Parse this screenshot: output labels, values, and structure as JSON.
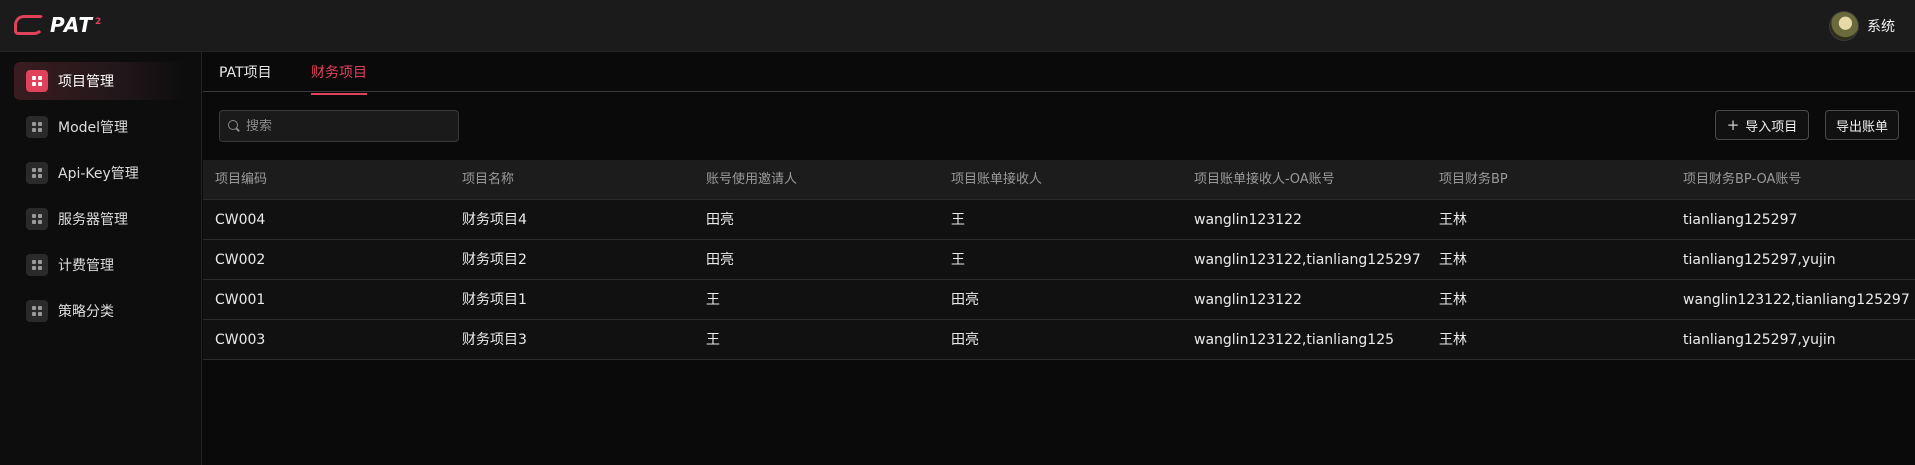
{
  "app": {
    "logo_text": "PAT",
    "logo_sup": "2"
  },
  "user": {
    "name": "系统"
  },
  "sidebar": {
    "items": [
      {
        "label": "项目管理",
        "active": true
      },
      {
        "label": "Model管理",
        "active": false
      },
      {
        "label": "Api-Key管理",
        "active": false
      },
      {
        "label": "服务器管理",
        "active": false
      },
      {
        "label": "计费管理",
        "active": false
      },
      {
        "label": "策略分类",
        "active": false
      }
    ]
  },
  "tabs": [
    {
      "label": "PAT项目",
      "active": false
    },
    {
      "label": "财务项目",
      "active": true
    }
  ],
  "search": {
    "placeholder": "搜索",
    "value": ""
  },
  "toolbar": {
    "import_label": "导入项目",
    "export_label": "导出账单"
  },
  "table": {
    "columns": [
      "项目编码",
      "项目名称",
      "账号使用邀请人",
      "项目账单接收人",
      "项目账单接收人-OA账号",
      "项目财务BP",
      "项目财务BP-OA账号"
    ],
    "rows": [
      [
        "CW004",
        "财务项目4",
        "田亮",
        "王",
        "wanglin123122",
        "王林",
        "tianliang125297"
      ],
      [
        "CW002",
        "财务项目2",
        "田亮",
        "王",
        "wanglin123122,tianliang125297",
        "王林",
        "tianliang125297,yujin"
      ],
      [
        "CW001",
        "财务项目1",
        "王",
        "田亮",
        "wanglin123122",
        "王林",
        "wanglin123122,tianliang125297"
      ],
      [
        "CW003",
        "财务项目3",
        "王",
        "田亮",
        "wanglin123122,tianliang125",
        "王林",
        "tianliang125297,yujin"
      ]
    ]
  },
  "colors": {
    "accent": "#e0415b",
    "background": "#0a0a0a",
    "topbar": "#1b1b1b"
  },
  "icons": {
    "logo": "pat-logo-icon",
    "avatar": "user-avatar",
    "nav": "grid-icon",
    "search": "search-icon",
    "add": "plus-icon"
  }
}
